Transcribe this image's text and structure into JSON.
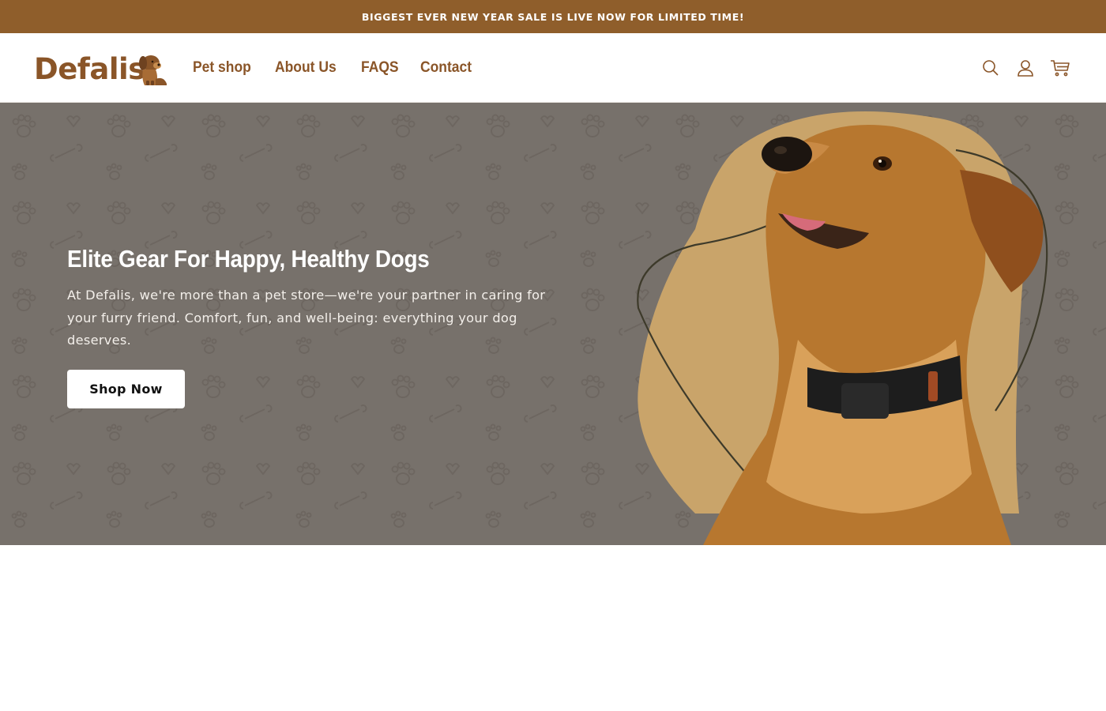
{
  "announcement": {
    "text": "BIGGEST EVER NEW YEAR SALE IS LIVE NOW FOR LIMITED TIME!"
  },
  "header": {
    "logo_text": "Defalis",
    "nav": [
      "Pet shop",
      "About Us",
      "FAQS",
      "Contact"
    ],
    "icons": [
      "search-icon",
      "account-icon",
      "cart-icon"
    ]
  },
  "hero": {
    "title": "Elite Gear For Happy, Healthy Dogs",
    "text": "At Defalis, we're more than a pet store—we're your partner in caring for your furry friend. Comfort, fun, and well-being: everything your dog deserves.",
    "button_label": "Shop Now"
  },
  "colors": {
    "announcement_bg": "#8f5e2b",
    "brand_brown": "#8a5528",
    "hero_bg": "#77716b",
    "blob": "#c9a46a"
  }
}
